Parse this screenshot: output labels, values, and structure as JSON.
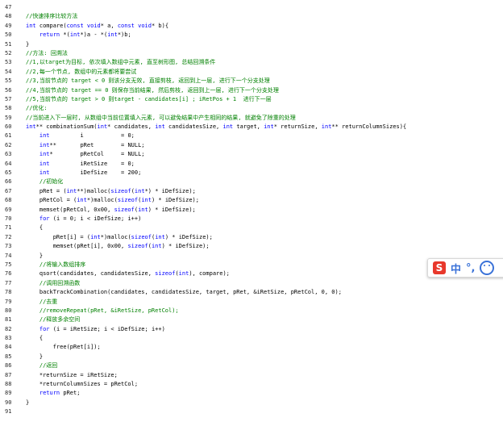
{
  "editor": {
    "lines": [
      {
        "n": "47",
        "t": ""
      },
      {
        "n": "48",
        "t": "//快速排序比较方法",
        "c": "cm"
      },
      {
        "n": "49",
        "t": "int compare(const void* a, const void* b){"
      },
      {
        "n": "50",
        "t": "    return *(int*)a - *(int*)b;"
      },
      {
        "n": "51",
        "t": "}"
      },
      {
        "n": "52",
        "t": "//方法: 回溯法",
        "c": "cm"
      },
      {
        "n": "53",
        "t": "//1,以target为目标, 依次填入数组中元素, 直至树形图, 总结回溯条件",
        "c": "cm"
      },
      {
        "n": "54",
        "t": "//2,每一个节点, 数组中的元素都将要尝试",
        "c": "cm"
      },
      {
        "n": "55",
        "t": "//3,当前节点的 target < 0 则该分支无效, 直接剪枝, 返回到上一层, 进行下一个分支处理",
        "c": "cm"
      },
      {
        "n": "56",
        "t": "//4,当前节点的 target == 0 则保存当前结果, 然后剪枝, 返回到上一层, 进行下一个分支处理",
        "c": "cm"
      },
      {
        "n": "57",
        "t": "//5,当前节点的 target > 0 则target - candidates[i] ; iRetPos + 1  进行下一层",
        "c": "cm"
      },
      {
        "n": "58",
        "t": "//优化:",
        "c": "cm"
      },
      {
        "n": "59",
        "t": "//当前进入下一层时, 从数组中当前位置填入元素, 可以避免结果中产生相同的结果, 就避免了除重的处理",
        "c": "cm"
      },
      {
        "n": "60",
        "t": "int** combinationSum(int* candidates, int candidatesSize, int target, int* returnSize, int** returnColumnSizes){"
      },
      {
        "n": "61",
        "t": "    int         i           = 0;"
      },
      {
        "n": "62",
        "t": "    int**       pRet        = NULL;"
      },
      {
        "n": "63",
        "t": "    int*        pRetCol     = NULL;"
      },
      {
        "n": "64",
        "t": "    int         iRetSize    = 0;"
      },
      {
        "n": "65",
        "t": "    int         iDefSize    = 200;"
      },
      {
        "n": "66",
        "t": "    //初始化",
        "c": "cm"
      },
      {
        "n": "67",
        "t": "    pRet = (int**)malloc(sizeof(int*) * iDefSize);"
      },
      {
        "n": "68",
        "t": "    pRetCol = (int*)malloc(sizeof(int) * iDefSize);"
      },
      {
        "n": "69",
        "t": "    memset(pRetCol, 0x00, sizeof(int) * iDefSize);"
      },
      {
        "n": "70",
        "t": "    for (i = 0; i < iDefSize; i++)"
      },
      {
        "n": "71",
        "t": "    {"
      },
      {
        "n": "72",
        "t": "        pRet[i] = (int*)malloc(sizeof(int) * iDefSize);"
      },
      {
        "n": "73",
        "t": "        memset(pRet[i], 0x00, sizeof(int) * iDefSize);"
      },
      {
        "n": "74",
        "t": "    }"
      },
      {
        "n": "75",
        "t": "    //将输入数组排序",
        "c": "cm"
      },
      {
        "n": "76",
        "t": "    qsort(candidates, candidatesSize, sizeof(int), compare);"
      },
      {
        "n": "77",
        "t": "    //调用回溯函数",
        "c": "cm"
      },
      {
        "n": "78",
        "t": "    backTrackCombination(candidates, candidatesSize, target, pRet, &iRetSize, pRetCol, 0, 0);"
      },
      {
        "n": "79",
        "t": "    //去重",
        "c": "cm"
      },
      {
        "n": "80",
        "t": "    //removeRepeat(pRet, &iRetSize, pRetCol);",
        "c": "cm"
      },
      {
        "n": "81",
        "t": "    //释放多余空间",
        "c": "cm"
      },
      {
        "n": "82",
        "t": "    for (i = iRetSize; i < iDefSize; i++)"
      },
      {
        "n": "83",
        "t": "    {"
      },
      {
        "n": "84",
        "t": "        free(pRet[i]);"
      },
      {
        "n": "85",
        "t": "    }"
      },
      {
        "n": "86",
        "t": "    //返回",
        "c": "cm"
      },
      {
        "n": "87",
        "t": "    *returnSize = iRetSize;"
      },
      {
        "n": "88",
        "t": "    *returnColumnSizes = pRetCol;"
      },
      {
        "n": "89",
        "t": "    return pRet;"
      },
      {
        "n": "90",
        "t": "}"
      },
      {
        "n": "91",
        "t": ""
      }
    ]
  },
  "ime": {
    "logo": "S",
    "lang": "中",
    "punct": "°,",
    "emoji_icon": "smiley-icon",
    "brand_color": "#e8382b",
    "accent_color": "#3a72d8"
  }
}
